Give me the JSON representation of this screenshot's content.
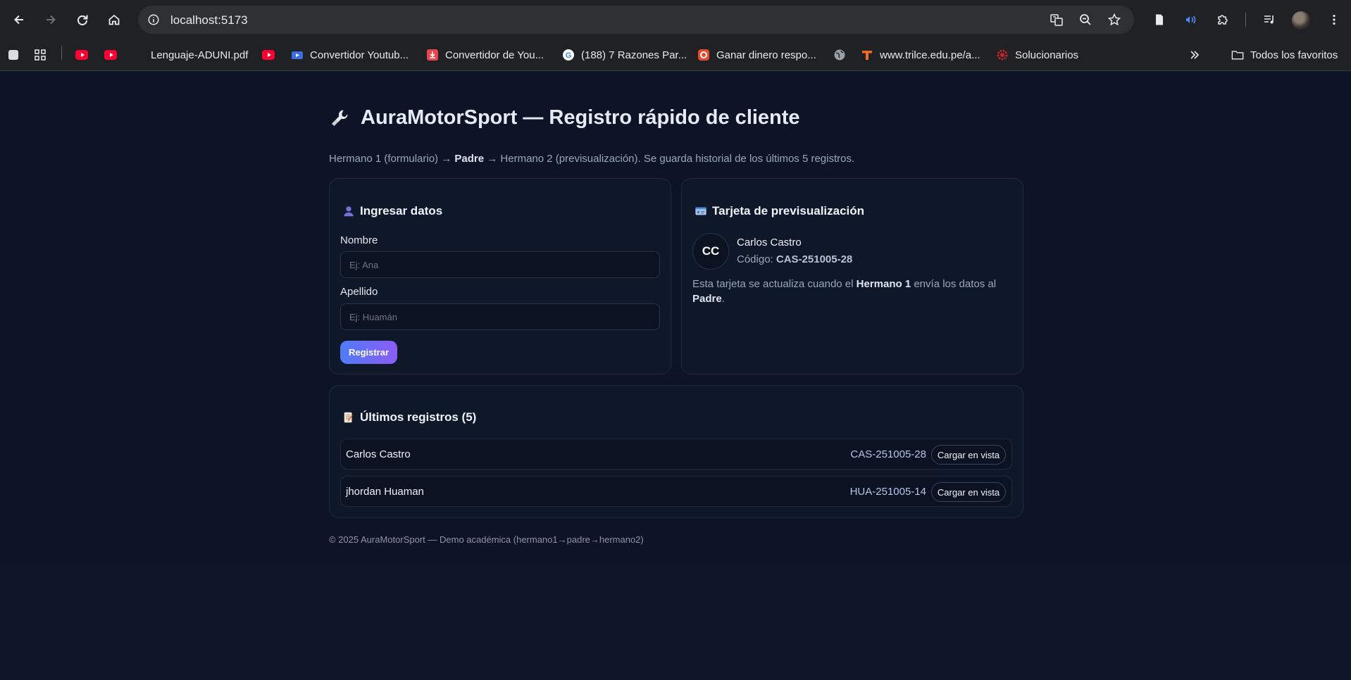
{
  "browser": {
    "url": "localhost:5173",
    "bookmarks": [
      {
        "label": "",
        "icon": "youtube-icon"
      },
      {
        "label": "",
        "icon": "youtube-icon"
      },
      {
        "label": "Lenguaje-ADUNI.pdf",
        "icon": ""
      },
      {
        "label": "",
        "icon": "youtube-icon"
      },
      {
        "label": "Convertidor Youtub...",
        "icon": "converter-icon"
      },
      {
        "label": "Convertidor de You...",
        "icon": "download-icon"
      },
      {
        "label": "(188) 7 Razones Par...",
        "icon": "google-icon"
      },
      {
        "label": "Ganar dinero respo...",
        "icon": "opinion-icon"
      },
      {
        "label": "",
        "icon": "globe-icon"
      },
      {
        "label": "www.trilce.edu.pe/a...",
        "icon": "trilce-icon"
      },
      {
        "label": "Solucionarios",
        "icon": "gear-red-icon"
      }
    ],
    "all_bookmarks": "Todos los favoritos"
  },
  "header": {
    "title": "AuraMotorSport — Registro rápido de cliente",
    "subtitle_pre": "Hermano 1 (formulario) → ",
    "subtitle_bold": "Padre",
    "subtitle_post": " → Hermano 2 (previsualización). Se guarda historial de los últimos 5 registros."
  },
  "form": {
    "heading": "Ingresar datos",
    "first_name_label": "Nombre",
    "first_name_placeholder": "Ej: Ana",
    "last_name_label": "Apellido",
    "last_name_placeholder": "Ej: Huamán",
    "submit_label": "Registrar"
  },
  "preview": {
    "heading": "Tarjeta de previsualización",
    "initials": "CC",
    "name": "Carlos Castro",
    "code_label": "Código: ",
    "code": "CAS-251005-28",
    "note_1": "Esta tarjeta se actualiza cuando el ",
    "note_bold_1": "Hermano 1",
    "note_2": " envía los datos al ",
    "note_bold_2": "Padre",
    "note_3": "."
  },
  "history": {
    "heading": "Últimos registros (5)",
    "rows": [
      {
        "name": "Carlos Castro",
        "code": "CAS-251005-28",
        "action": "Cargar en vista"
      },
      {
        "name": "jhordan Huaman",
        "code": "HUA-251005-14",
        "action": "Cargar en vista"
      }
    ]
  },
  "footer": {
    "text": "© 2025 AuraMotorSport — Demo académica (hermano1→padre→hermano2)"
  },
  "colors": {
    "page_bg": "#0c1426",
    "card_bg": "#0f1829",
    "accent_start": "#4f7cf7",
    "accent_end": "#8b5cf6"
  }
}
